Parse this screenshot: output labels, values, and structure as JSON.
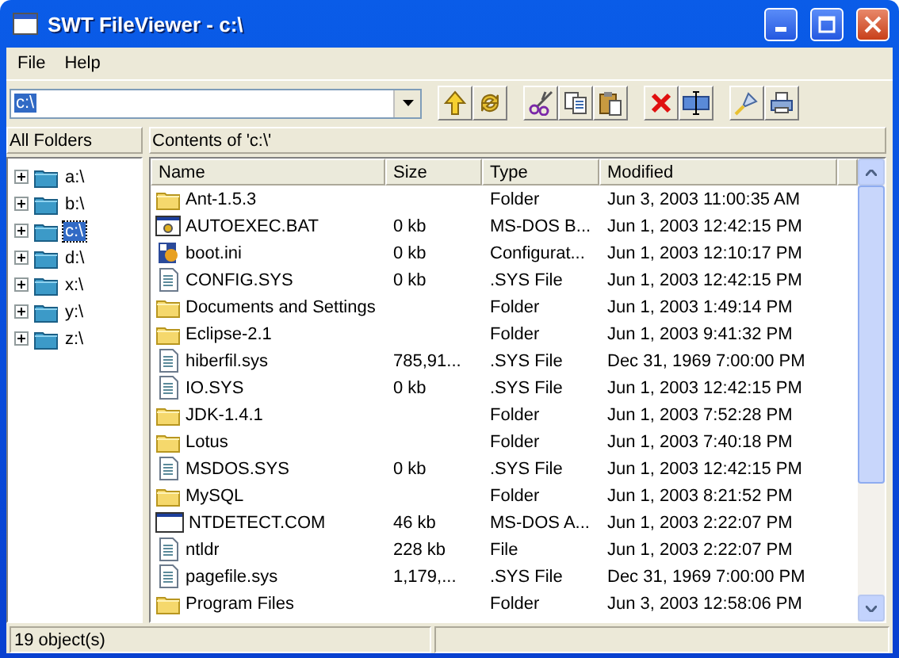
{
  "window": {
    "title": "SWT FileViewer - c:\\"
  },
  "menu": [
    "File",
    "Help"
  ],
  "address": {
    "value": "c:\\"
  },
  "toolbar": [
    {
      "kind": "up"
    },
    {
      "kind": "refresh"
    },
    {
      "kind": "sep"
    },
    {
      "kind": "cut"
    },
    {
      "kind": "copy"
    },
    {
      "kind": "paste"
    },
    {
      "kind": "sep"
    },
    {
      "kind": "delete"
    },
    {
      "kind": "rename"
    },
    {
      "kind": "sep"
    },
    {
      "kind": "run"
    },
    {
      "kind": "print"
    }
  ],
  "tree": {
    "title": "All Folders",
    "items": [
      {
        "label": "a:\\",
        "selected": false
      },
      {
        "label": "b:\\",
        "selected": false
      },
      {
        "label": "c:\\",
        "selected": true
      },
      {
        "label": "d:\\",
        "selected": false
      },
      {
        "label": "x:\\",
        "selected": false
      },
      {
        "label": "y:\\",
        "selected": false
      },
      {
        "label": "z:\\",
        "selected": false
      }
    ]
  },
  "table": {
    "title": "Contents of 'c:\\'",
    "columns": [
      "Name",
      "Size",
      "Type",
      "Modified"
    ],
    "rows": [
      {
        "kind": "folder",
        "name": "Ant-1.5.3",
        "size": "",
        "type": "Folder",
        "modified": "Jun 3, 2003 11:00:35 AM"
      },
      {
        "kind": "bat",
        "name": "AUTOEXEC.BAT",
        "size": "0 kb",
        "type": "MS-DOS B...",
        "modified": "Jun 1, 2003 12:42:15 PM"
      },
      {
        "kind": "ini",
        "name": "boot.ini",
        "size": "0 kb",
        "type": "Configurat...",
        "modified": "Jun 1, 2003 12:10:17 PM"
      },
      {
        "kind": "file",
        "name": "CONFIG.SYS",
        "size": "0 kb",
        "type": ".SYS File",
        "modified": "Jun 1, 2003 12:42:15 PM"
      },
      {
        "kind": "folder",
        "name": "Documents and Settings",
        "size": "",
        "type": "Folder",
        "modified": "Jun 1, 2003 1:49:14 PM"
      },
      {
        "kind": "folder",
        "name": "Eclipse-2.1",
        "size": "",
        "type": "Folder",
        "modified": "Jun 1, 2003 9:41:32 PM"
      },
      {
        "kind": "file",
        "name": "hiberfil.sys",
        "size": "785,91...",
        "type": ".SYS File",
        "modified": "Dec 31, 1969 7:00:00 PM"
      },
      {
        "kind": "file",
        "name": "IO.SYS",
        "size": "0 kb",
        "type": ".SYS File",
        "modified": "Jun 1, 2003 12:42:15 PM"
      },
      {
        "kind": "folder",
        "name": "JDK-1.4.1",
        "size": "",
        "type": "Folder",
        "modified": "Jun 1, 2003 7:52:28 PM"
      },
      {
        "kind": "folder",
        "name": "Lotus",
        "size": "",
        "type": "Folder",
        "modified": "Jun 1, 2003 7:40:18 PM"
      },
      {
        "kind": "file",
        "name": "MSDOS.SYS",
        "size": "0 kb",
        "type": ".SYS File",
        "modified": "Jun 1, 2003 12:42:15 PM"
      },
      {
        "kind": "folder",
        "name": "MySQL",
        "size": "",
        "type": "Folder",
        "modified": "Jun 1, 2003 8:21:52 PM"
      },
      {
        "kind": "com",
        "name": "NTDETECT.COM",
        "size": "46 kb",
        "type": "MS-DOS A...",
        "modified": "Jun 1, 2003 2:22:07 PM"
      },
      {
        "kind": "file",
        "name": "ntldr",
        "size": "228 kb",
        "type": "File",
        "modified": "Jun 1, 2003 2:22:07 PM"
      },
      {
        "kind": "file",
        "name": "pagefile.sys",
        "size": "1,179,...",
        "type": ".SYS File",
        "modified": "Dec 31, 1969 7:00:00 PM"
      },
      {
        "kind": "folder",
        "name": "Program Files",
        "size": "",
        "type": "Folder",
        "modified": "Jun 3, 2003 12:58:06 PM"
      }
    ]
  },
  "status_bar": "19 object(s)"
}
